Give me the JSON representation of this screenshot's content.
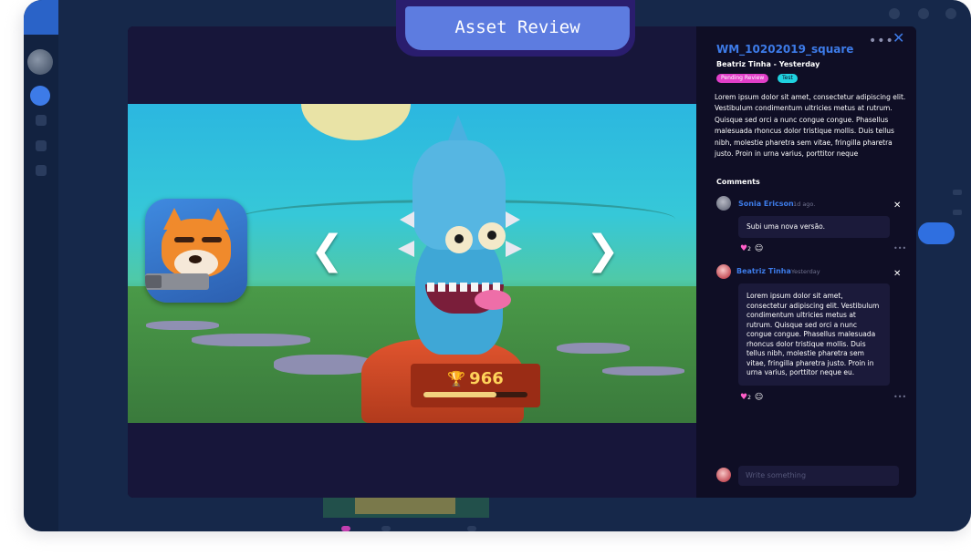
{
  "banner": {
    "title": "Asset Review"
  },
  "viewer": {
    "prev_icon": "chevron-left-icon",
    "next_icon": "chevron-right-icon",
    "trophy_count": "966",
    "trophy_progress": 0.7
  },
  "panel": {
    "menu_icon": "•••",
    "close_icon": "✕",
    "asset_title": "WM_10202019_square",
    "asset_subtitle": "Beatriz Tinha - Yesterday",
    "tags": [
      "Pending Review",
      "Test"
    ],
    "tag_colors": [
      "#e23fc9",
      "#1fd2e0"
    ],
    "description": "Lorem ipsum dolor sit amet, consectetur adipiscing elit. Vestibulum condimentum ultricies metus at rutrum. Quisque sed orci a nunc congue congue. Phasellus malesuada rhoncus dolor tristique mollis. Duis tellus nibh, molestie pharetra sem vitae, fringilla pharetra justo. Proin in urna varius, porttitor neque",
    "comments_header": "Comments",
    "comments": [
      {
        "author": "Sonia Ericson",
        "time": "1d ago.",
        "text": "Subi uma nova versão.",
        "reaction": "♥",
        "reaction_count": "2",
        "add_reaction": "☺"
      },
      {
        "author": "Beatriz Tinha",
        "time": "Yesterday",
        "text": "Lorem ipsum dolor sit amet, consectetur adipiscing elit. Vestibulum condimentum ultricies metus at rutrum. Quisque sed orci a nunc congue congue. Phasellus malesuada rhoncus dolor tristique mollis. Duis tellus nibh, molestie pharetra sem vitae, fringilla pharetra justo. Proin in urna varius, porttitor neque eu.",
        "reaction": "♥",
        "reaction_count": "2",
        "add_reaction": "☺"
      }
    ],
    "write_placeholder": "Write something",
    "more_icon": "•••"
  },
  "colors": {
    "accent": "#3d7be8",
    "background": "#0f0e25",
    "banner": "#5d7ce0"
  }
}
